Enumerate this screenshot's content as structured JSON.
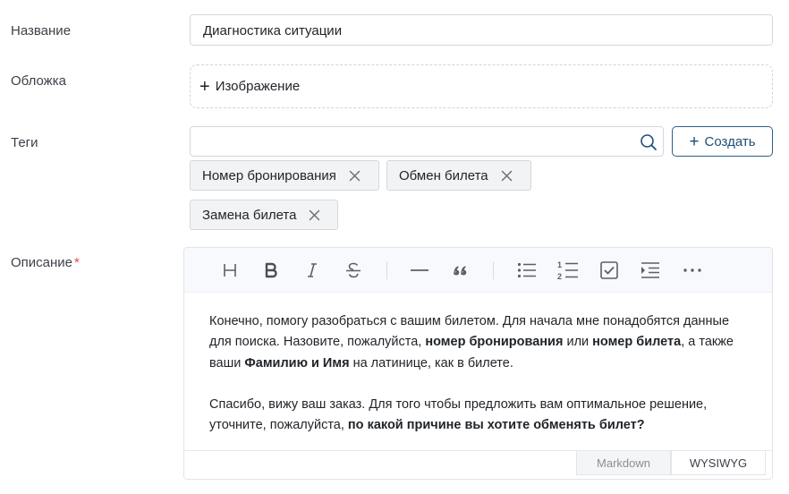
{
  "fields": {
    "name_label": "Название",
    "name_value": "Диагностика ситуации",
    "cover_label": "Обложка",
    "cover_button": "Изображение",
    "tags_label": "Теги",
    "tags_search_value": "",
    "create_button": "Создать",
    "tags": [
      "Номер бронирования",
      "Обмен билета",
      "Замена билета"
    ],
    "description_label": "Описание",
    "required_mark": "*"
  },
  "editor": {
    "toolbar_icons": [
      "heading-icon",
      "bold-icon",
      "italic-icon",
      "strikethrough-icon",
      "horizontal-rule-icon",
      "quote-icon",
      "bullet-list-icon",
      "ordered-list-icon",
      "task-list-icon",
      "indent-icon",
      "more-icon"
    ],
    "paragraph1": {
      "t1": "Конечно, помогу разобраться с вашим билетом. Для начала мне понадобятся данные для поиска. Назовите, пожалуйста, ",
      "b1": "номер бронирования",
      "t2": " или ",
      "b2": "номер билета",
      "t3": ", а также ваши ",
      "b3": "Фамилию и Имя",
      "t4": " на латинице, как в билете."
    },
    "paragraph2": {
      "t1": "Спасибо, вижу ваш заказ. Для того чтобы предложить вам оптимальное решение, уточните, пожалуйста, ",
      "b1": "по какой причине вы хотите обменять билет?"
    },
    "modes": {
      "markdown": "Markdown",
      "wysiwyg": "WYSIWYG",
      "active": "WYSIWYG"
    }
  },
  "colors": {
    "accent": "#1d4e78",
    "required": "#e5484d"
  }
}
